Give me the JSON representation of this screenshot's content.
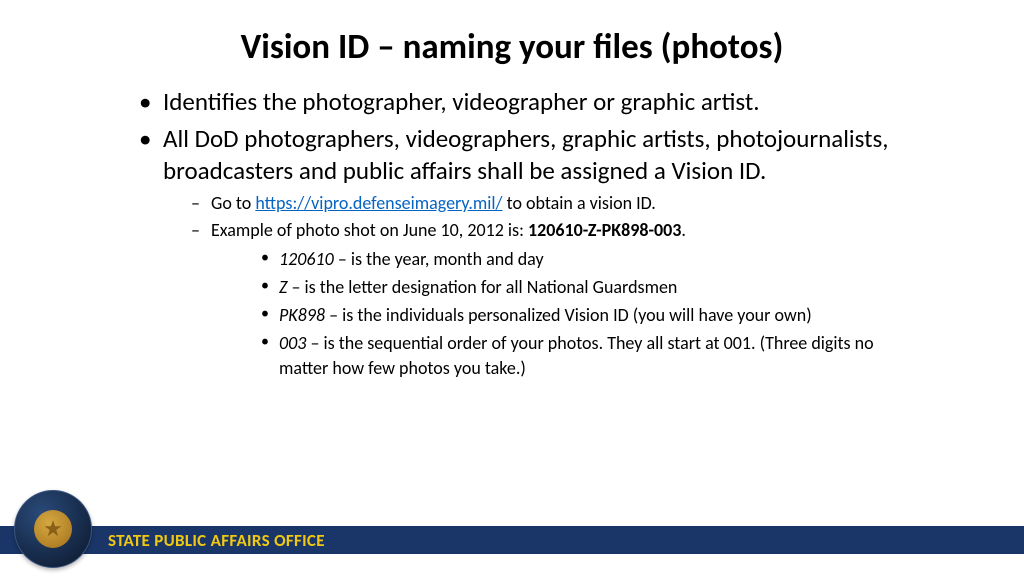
{
  "title": "Vision ID – naming your files (photos)",
  "bullets": {
    "b1": "Identifies the photographer, videographer or graphic artist.",
    "b2": "All DoD photographers, videographers, graphic artists, photojournalists, broadcasters and public affairs shall be assigned a Vision ID.",
    "sub1_pre": "Go to ",
    "sub1_link": "https://vipro.defenseimagery.mil/",
    "sub1_post": " to obtain a vision ID.",
    "sub2_pre": "Example of photo shot on June 10, 2012 is: ",
    "sub2_bold": "120610-Z-PK898-003",
    "sub2_post": ".",
    "ssb1_i": "120610",
    "ssb1_t": " – is the year, month and day",
    "ssb2_i": "Z",
    "ssb2_t": " – is the letter designation for all National Guardsmen",
    "ssb3_i": "PK898",
    "ssb3_t": " – is the individuals personalized Vision ID (you will have your own)",
    "ssb4_i": "003",
    "ssb4_t": " – is the sequential order of your photos. They all start at 001. (Three digits no matter how few photos you take.)"
  },
  "footer": {
    "office": "STATE PUBLIC AFFAIRS OFFICE",
    "seal_star": "★"
  }
}
